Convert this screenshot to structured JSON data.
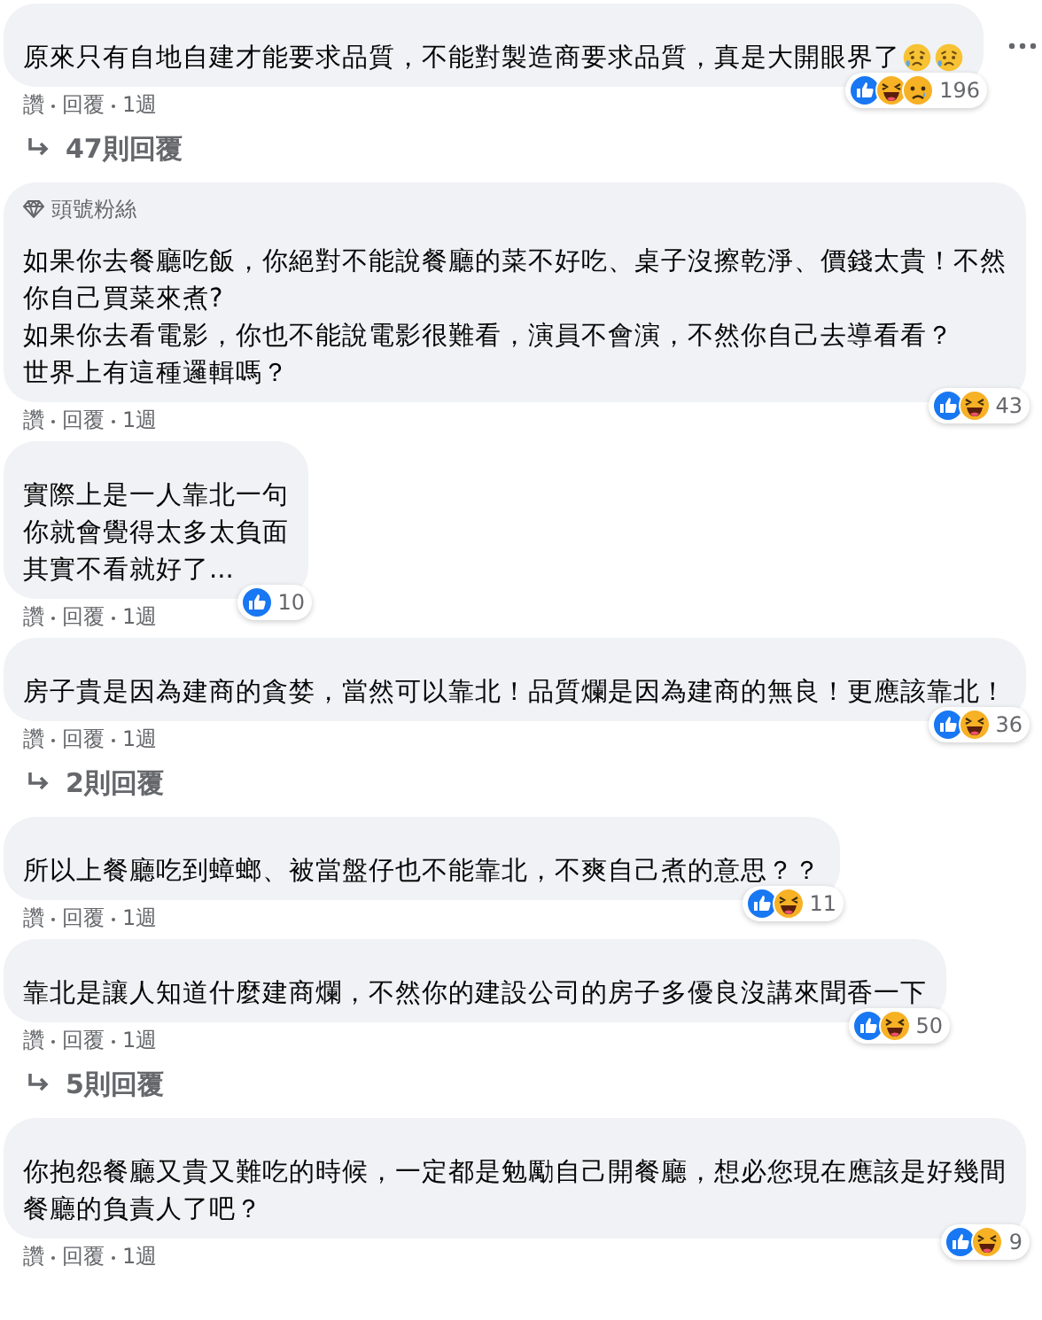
{
  "thread": [
    {
      "kind": "comment",
      "menu": true,
      "lines": [
        "原來只有自地自建才能要求品質，不能對製造商要求品質，真是大開眼界了"
      ],
      "emoji": [
        {
          "kind": "worried"
        },
        {
          "kind": "worried"
        }
      ],
      "reactions": [
        {
          "kind": "like"
        },
        {
          "kind": "haha"
        },
        {
          "kind": "sad"
        }
      ],
      "count": "196",
      "actions": [
        "讚",
        "回覆",
        "1週"
      ]
    },
    {
      "kind": "replies",
      "label": "47則回覆"
    },
    {
      "kind": "comment",
      "badge": "頭號粉絲",
      "lines": [
        "如果你去餐廳吃飯，你絕對不能說餐廳的菜不好吃、桌子沒擦乾淨、價錢太貴！不然",
        "你自己買菜來煮?",
        "如果你去看電影，你也不能說電影很難看，演員不會演，不然你自己去導看看？",
        "世界上有這種邏輯嗎？"
      ],
      "reactions": [
        {
          "kind": "like"
        },
        {
          "kind": "haha"
        }
      ],
      "count": "43",
      "actions": [
        "讚",
        "回覆",
        "1週"
      ]
    },
    {
      "kind": "comment",
      "lines": [
        "實際上是一人靠北一句",
        "你就會覺得太多太負面",
        "其實不看就好了..."
      ],
      "reactions": [
        {
          "kind": "like"
        }
      ],
      "count": "10",
      "actions": [
        "讚",
        "回覆",
        "1週"
      ]
    },
    {
      "kind": "comment",
      "lines": [
        "房子貴是因為建商的貪婪，當然可以靠北！品質爛是因為建商的無良！更應該靠北！"
      ],
      "reactions": [
        {
          "kind": "like"
        },
        {
          "kind": "haha"
        }
      ],
      "count": "36",
      "actions": [
        "讚",
        "回覆",
        "1週"
      ]
    },
    {
      "kind": "replies",
      "label": "2則回覆"
    },
    {
      "kind": "comment",
      "lines": [
        "所以上餐廳吃到蟑螂、被當盤仔也不能靠北，不爽自己煮的意思？？"
      ],
      "reactions": [
        {
          "kind": "like"
        },
        {
          "kind": "haha"
        }
      ],
      "count": "11",
      "actions": [
        "讚",
        "回覆",
        "1週"
      ]
    },
    {
      "kind": "comment",
      "lines": [
        "靠北是讓人知道什麼建商爛，不然你的建設公司的房子多優良沒講來聞香一下"
      ],
      "reactions": [
        {
          "kind": "like"
        },
        {
          "kind": "haha"
        }
      ],
      "count": "50",
      "actions": [
        "讚",
        "回覆",
        "1週"
      ]
    },
    {
      "kind": "replies",
      "label": "5則回覆"
    },
    {
      "kind": "comment",
      "lines": [
        "你抱怨餐廳又貴又難吃的時候，一定都是勉勵自己開餐廳，想必您現在應該是好幾間",
        "餐廳的負責人了吧？"
      ],
      "reactions": [
        {
          "kind": "like"
        },
        {
          "kind": "haha"
        }
      ],
      "count": "9",
      "actions": [
        "讚",
        "回覆",
        "1週"
      ]
    }
  ]
}
